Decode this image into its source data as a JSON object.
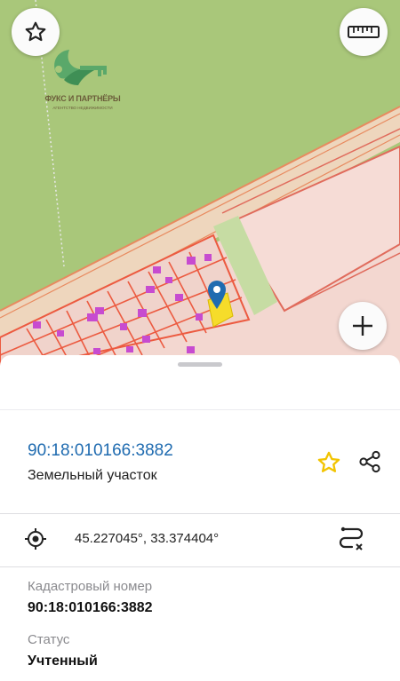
{
  "map": {
    "logo": {
      "name": "ФУКС И ПАРТНЁРЫ",
      "tagline": "АГЕНТСТВО НЕДВИЖИМОСТИ"
    },
    "buttons": {
      "favorite_icon": "star-outline-icon",
      "ruler_icon": "ruler-icon",
      "zoom_in_icon": "plus-icon"
    },
    "colors": {
      "green_area": "#a9c77a",
      "parcel_fill": "#f3d7d0",
      "parcel_border": "#e97a55",
      "building": "#c74bd0",
      "selected_parcel": "#f6dc2a",
      "pin": "#1f6bb0"
    }
  },
  "sheet": {
    "cadastral_number_link": "90:18:010166:3882",
    "object_type": "Земельный участок",
    "coordinates": "45.227045°, 33.374404°",
    "fields": [
      {
        "label": "Кадастровый номер",
        "value": "90:18:010166:3882"
      },
      {
        "label": "Статус",
        "value": "Учтенный"
      }
    ],
    "icons": {
      "favorite": "star-icon",
      "share": "share-icon",
      "locate": "location-target-icon",
      "route": "route-icon"
    },
    "colors": {
      "link": "#1f6bb0",
      "star": "#f2c400"
    }
  }
}
